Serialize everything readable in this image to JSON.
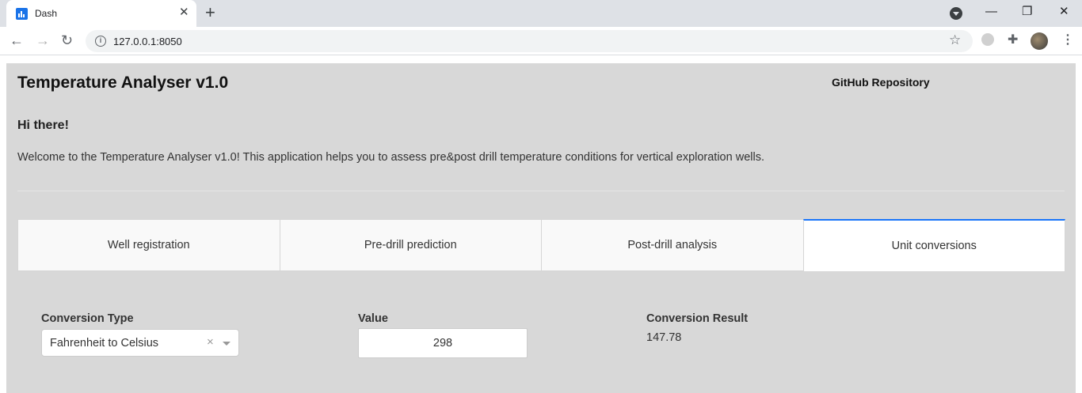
{
  "browser": {
    "tab_title": "Dash",
    "tab_close": "✕",
    "new_tab": "+",
    "url": "127.0.0.1:8050",
    "window_controls": {
      "minimize": "—",
      "restore": "❐",
      "close": "✕"
    }
  },
  "header": {
    "title": "Temperature Analyser v1.0",
    "github_link": "GitHub Repository"
  },
  "intro": {
    "greeting": "Hi there!",
    "welcome": "Welcome to the Temperature Analyser v1.0! This application helps you to assess pre&post drill temperature conditions for vertical exploration wells."
  },
  "tabs": [
    {
      "label": "Well registration",
      "active": false
    },
    {
      "label": "Pre-drill prediction",
      "active": false
    },
    {
      "label": "Post-drill analysis",
      "active": false
    },
    {
      "label": "Unit conversions",
      "active": true
    }
  ],
  "conversion": {
    "type_label": "Conversion Type",
    "type_value": "Fahrenheit to Celsius",
    "value_label": "Value",
    "value": "298",
    "result_label": "Conversion Result",
    "result": "147.78"
  },
  "colors": {
    "page_background": "#d8d8d8",
    "active_tab_accent": "#1975fa"
  }
}
